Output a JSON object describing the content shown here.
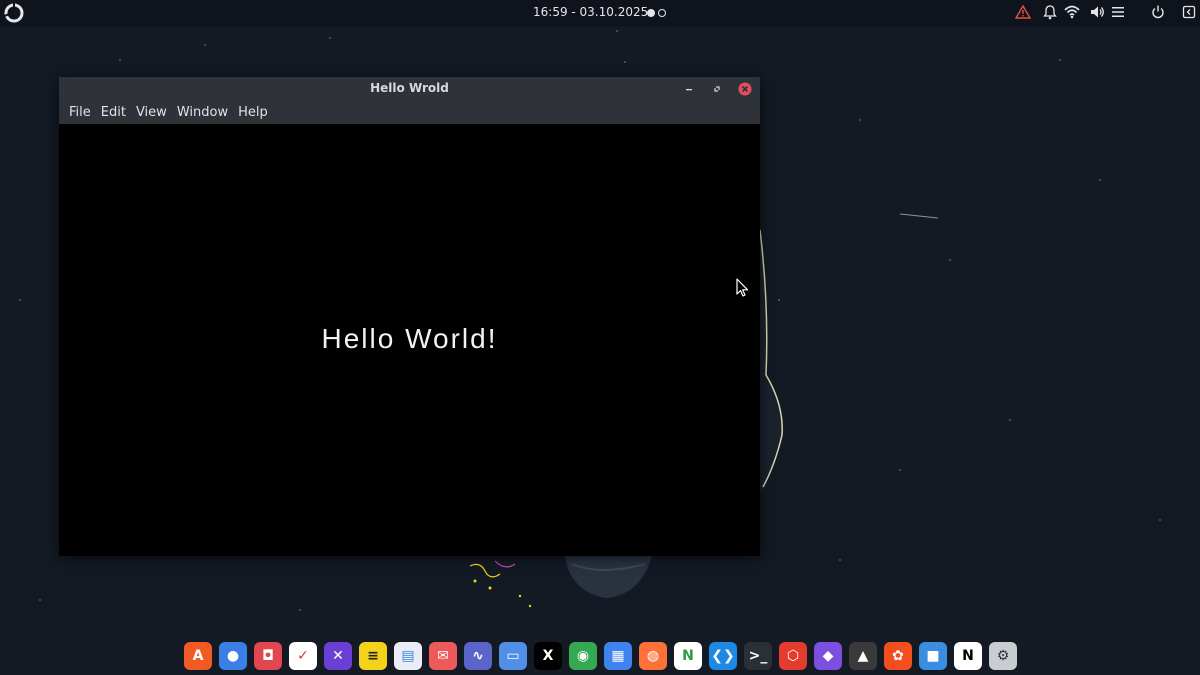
{
  "topbar": {
    "clock": "16:59 - 03.10.2025",
    "workspaces": [
      {
        "active": true
      },
      {
        "active": false
      }
    ],
    "tray_icons": [
      "warning-icon",
      "bell-icon",
      "wifi-icon",
      "volume-icon",
      "menu-icon",
      "power-icon",
      "exit-icon"
    ],
    "warning_color": "#e0533f"
  },
  "window": {
    "title": "Hello Wrold",
    "menu": [
      "File",
      "Edit",
      "View",
      "Window",
      "Help"
    ],
    "content_text": "Hello World!",
    "close_color": "#e0505a"
  },
  "dock": {
    "apps": [
      {
        "name": "app-store",
        "glyph": "A",
        "bg": "#f15a24"
      },
      {
        "name": "toggle",
        "glyph": "●",
        "bg": "#3b7fe6"
      },
      {
        "name": "screenshot",
        "glyph": "◘",
        "bg": "#e2474f"
      },
      {
        "name": "todo",
        "glyph": "✓",
        "bg": "#ffffff",
        "fg": "#d33"
      },
      {
        "name": "editor",
        "glyph": "✕",
        "bg": "#6b3fd6"
      },
      {
        "name": "notes",
        "glyph": "≡",
        "bg": "#f4d21b",
        "fg": "#222"
      },
      {
        "name": "documents",
        "glyph": "▤",
        "bg": "#e9eef5",
        "fg": "#3b7fe6"
      },
      {
        "name": "mail",
        "glyph": "✉",
        "bg": "#ee5a5a"
      },
      {
        "name": "monitor",
        "glyph": "∿",
        "bg": "#5b64c9"
      },
      {
        "name": "files",
        "glyph": "▭",
        "bg": "#4f8fe8"
      },
      {
        "name": "x",
        "glyph": "X",
        "bg": "#000000"
      },
      {
        "name": "chrome",
        "glyph": "◉",
        "bg": "#34a853"
      },
      {
        "name": "grid-apps",
        "glyph": "▦",
        "bg": "#3f82f0"
      },
      {
        "name": "firefox",
        "glyph": "◍",
        "bg": "#ff7139"
      },
      {
        "name": "nginx",
        "glyph": "N",
        "bg": "#ffffff",
        "fg": "#2d9a3f"
      },
      {
        "name": "vscode",
        "glyph": "❮❯",
        "bg": "#1e88e5"
      },
      {
        "name": "terminal",
        "glyph": ">_",
        "bg": "#2b2f36"
      },
      {
        "name": "pdf",
        "glyph": "⬡",
        "bg": "#e33b2e"
      },
      {
        "name": "obsidian",
        "glyph": "◆",
        "bg": "#7b4fe0"
      },
      {
        "name": "inkscape",
        "glyph": "▲",
        "bg": "#3a3a3a"
      },
      {
        "name": "figma",
        "glyph": "✿",
        "bg": "#f24e1e"
      },
      {
        "name": "box",
        "glyph": "■",
        "bg": "#3a8de0"
      },
      {
        "name": "notion",
        "glyph": "N",
        "bg": "#ffffff",
        "fg": "#000"
      },
      {
        "name": "settings",
        "glyph": "⚙",
        "bg": "#c9ccd1",
        "fg": "#333"
      }
    ]
  }
}
